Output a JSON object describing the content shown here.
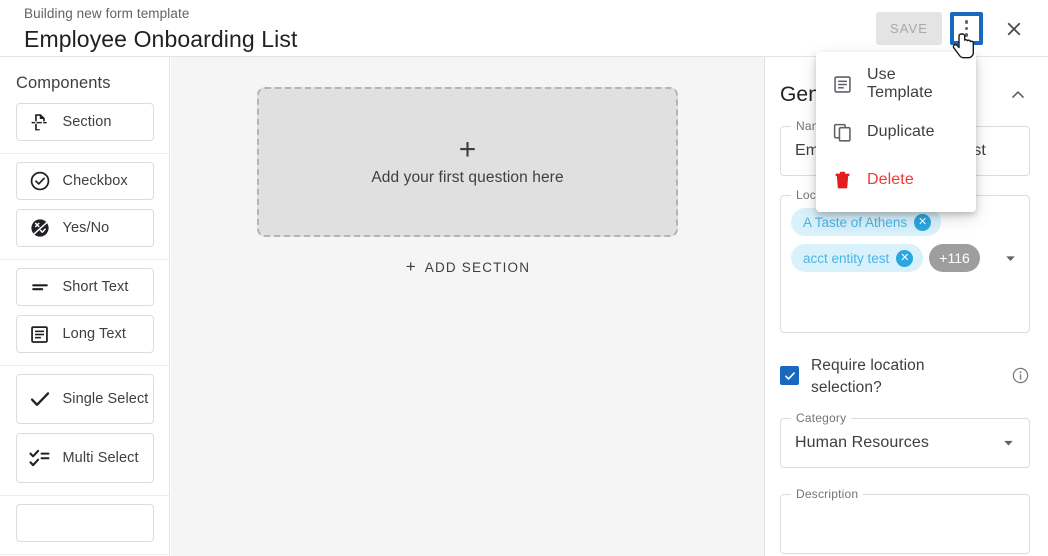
{
  "header": {
    "eyebrow": "Building new form template",
    "title": "Employee Onboarding List",
    "save_label": "SAVE",
    "kebab_name": "more-options",
    "close_name": "close",
    "focus_color": "#1769c0"
  },
  "menu": {
    "items": [
      {
        "label": "Use Template",
        "icon": "template-icon",
        "danger": false
      },
      {
        "label": "Duplicate",
        "icon": "duplicate-icon",
        "danger": false
      },
      {
        "label": "Delete",
        "icon": "trash-icon",
        "danger": true
      }
    ],
    "danger_color": "#ef3b36"
  },
  "sidebar": {
    "title": "Components",
    "groups": [
      {
        "items": [
          {
            "label": "Section",
            "icon": "section-icon",
            "tall": false
          }
        ]
      },
      {
        "items": [
          {
            "label": "Checkbox",
            "icon": "checkbox-circle-icon",
            "tall": false
          },
          {
            "label": "Yes/No",
            "icon": "yes-no-icon",
            "tall": false
          }
        ]
      },
      {
        "items": [
          {
            "label": "Short Text",
            "icon": "short-text-icon",
            "tall": false
          },
          {
            "label": "Long Text",
            "icon": "long-text-icon",
            "tall": false
          }
        ]
      },
      {
        "items": [
          {
            "label": "Single Select",
            "icon": "single-select-icon",
            "tall": true
          },
          {
            "label": "Multi Select",
            "icon": "multi-select-icon",
            "tall": true
          }
        ]
      }
    ]
  },
  "canvas": {
    "dropzone_plus": "+",
    "dropzone_text": "Add your first question here",
    "add_section_plus": "+",
    "add_section_label": "ADD SECTION"
  },
  "panel": {
    "title": "General",
    "collapse_icon": "chevron-up-icon",
    "name_field": {
      "legend": "Name",
      "value": "Employee Onboarding List"
    },
    "locations_field": {
      "legend": "Location(s)",
      "chips": [
        {
          "label": "A Taste of Athens"
        },
        {
          "label": "acct entity test"
        }
      ],
      "more_label": "+116",
      "chip_bg": "#d9f1fb",
      "chip_text": "#49b5e7",
      "more_bg": "#9e9e9e"
    },
    "require_location": {
      "label": "Require location selection?",
      "checked": true,
      "check_color": "#1769c0",
      "info_icon": "info-icon"
    },
    "category_field": {
      "legend": "Category",
      "value": "Human Resources"
    },
    "description_field": {
      "legend": "Description",
      "value": ""
    }
  }
}
